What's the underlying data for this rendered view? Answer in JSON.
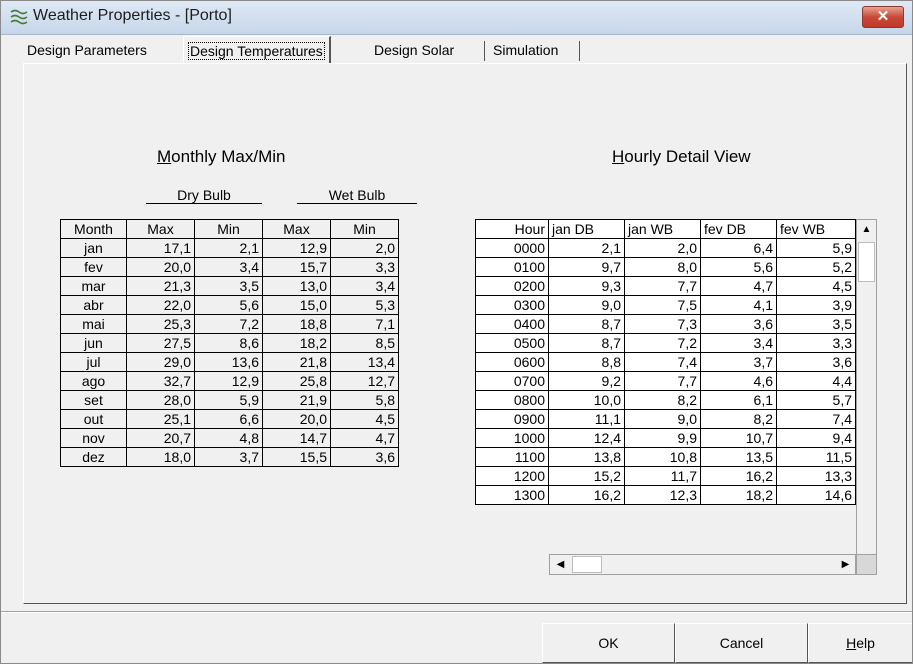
{
  "window": {
    "title": "Weather Properties - [Porto]",
    "close": "✕"
  },
  "tabs": [
    "Design Parameters",
    "Design Temperatures",
    "Design Solar",
    "Simulation"
  ],
  "monthly": {
    "title_u": "M",
    "title_rest": "onthly Max/Min",
    "dry_bulb": "Dry Bulb",
    "wet_bulb": "Wet Bulb",
    "headers": [
      "Month",
      "Max",
      "Min",
      "Max",
      "Min"
    ],
    "rows": [
      [
        "jan",
        "17,1",
        "2,1",
        "12,9",
        "2,0"
      ],
      [
        "fev",
        "20,0",
        "3,4",
        "15,7",
        "3,3"
      ],
      [
        "mar",
        "21,3",
        "3,5",
        "13,0",
        "3,4"
      ],
      [
        "abr",
        "22,0",
        "5,6",
        "15,0",
        "5,3"
      ],
      [
        "mai",
        "25,3",
        "7,2",
        "18,8",
        "7,1"
      ],
      [
        "jun",
        "27,5",
        "8,6",
        "18,2",
        "8,5"
      ],
      [
        "jul",
        "29,0",
        "13,6",
        "21,8",
        "13,4"
      ],
      [
        "ago",
        "32,7",
        "12,9",
        "25,8",
        "12,7"
      ],
      [
        "set",
        "28,0",
        "5,9",
        "21,9",
        "5,8"
      ],
      [
        "out",
        "25,1",
        "6,6",
        "20,0",
        "4,5"
      ],
      [
        "nov",
        "20,7",
        "4,8",
        "14,7",
        "4,7"
      ],
      [
        "dez",
        "18,0",
        "3,7",
        "15,5",
        "3,6"
      ]
    ]
  },
  "hourly": {
    "title_u": "H",
    "title_rest": "ourly Detail View",
    "headers": [
      "Hour",
      "jan DB",
      "jan WB",
      "fev DB",
      "fev WB"
    ],
    "rows": [
      [
        "0000",
        "2,1",
        "2,0",
        "6,4",
        "5,9"
      ],
      [
        "0100",
        "9,7",
        "8,0",
        "5,6",
        "5,2"
      ],
      [
        "0200",
        "9,3",
        "7,7",
        "4,7",
        "4,5"
      ],
      [
        "0300",
        "9,0",
        "7,5",
        "4,1",
        "3,9"
      ],
      [
        "0400",
        "8,7",
        "7,3",
        "3,6",
        "3,5"
      ],
      [
        "0500",
        "8,7",
        "7,2",
        "3,4",
        "3,3"
      ],
      [
        "0600",
        "8,8",
        "7,4",
        "3,7",
        "3,6"
      ],
      [
        "0700",
        "9,2",
        "7,7",
        "4,6",
        "4,4"
      ],
      [
        "0800",
        "10,0",
        "8,2",
        "6,1",
        "5,7"
      ],
      [
        "0900",
        "11,1",
        "9,0",
        "8,2",
        "7,4"
      ],
      [
        "1000",
        "12,4",
        "9,9",
        "10,7",
        "9,4"
      ],
      [
        "1100",
        "13,8",
        "10,8",
        "13,5",
        "11,5"
      ],
      [
        "1200",
        "15,2",
        "11,7",
        "16,2",
        "13,3"
      ],
      [
        "1300",
        "16,2",
        "12,3",
        "18,2",
        "14,6"
      ]
    ]
  },
  "buttons": {
    "ok": "OK",
    "cancel": "Cancel",
    "help_u": "H",
    "help_rest": "elp"
  },
  "icons": {
    "app": "weather-app-icon",
    "close": "close-icon",
    "up": "scroll-up-arrow-icon",
    "down": "scroll-down-arrow-icon",
    "left": "scroll-left-arrow-icon",
    "right": "scroll-right-arrow-icon"
  },
  "colors": {
    "close_button": "#c74a37",
    "titlebar": "#dfe9f5"
  }
}
